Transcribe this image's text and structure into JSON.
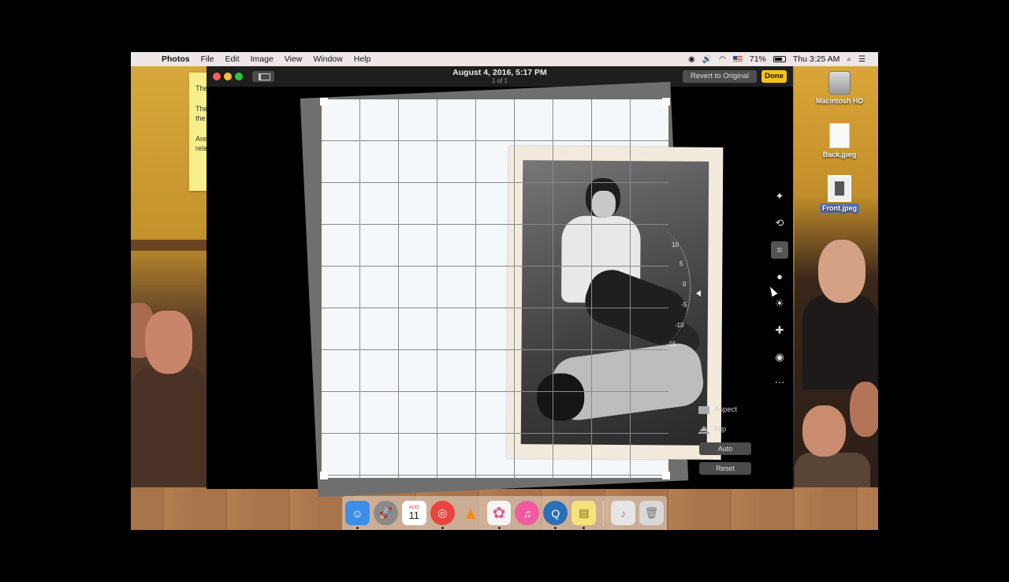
{
  "menubar": {
    "app_name": "Photos",
    "menus": [
      "File",
      "Edit",
      "Image",
      "View",
      "Window",
      "Help"
    ],
    "battery": "71%",
    "clock": "Thu 3:25 AM"
  },
  "sticky": {
    "lines": [
      "The",
      "The\nthe",
      "Are\nrela"
    ]
  },
  "desktop": {
    "icons": [
      {
        "label": "Macintosh HD"
      },
      {
        "label": "Back.jpeg"
      },
      {
        "label": "Front.jpeg"
      }
    ]
  },
  "window": {
    "title": "August 4, 2016, 5:17 PM",
    "subtitle": "1 of 1",
    "revert_label": "Revert to Original",
    "done_label": "Done"
  },
  "dial": {
    "ticks": [
      "10",
      "5",
      "0",
      "-5",
      "-10",
      "-15"
    ]
  },
  "tools": [
    {
      "name": "enhance-wand-icon",
      "glyph": "✦"
    },
    {
      "name": "rotate-icon",
      "glyph": "⟲"
    },
    {
      "name": "crop-icon",
      "glyph": "⌗"
    },
    {
      "name": "filters-icon",
      "glyph": "●"
    },
    {
      "name": "adjust-icon",
      "glyph": "☀"
    },
    {
      "name": "retouch-bandage-icon",
      "glyph": "✚"
    },
    {
      "name": "red-eye-icon",
      "glyph": "◉"
    },
    {
      "name": "more-icon",
      "glyph": "⋯"
    }
  ],
  "controls": {
    "aspect_label": "Aspect",
    "flip_label": "Flip",
    "auto_label": "Auto",
    "reset_label": "Reset"
  },
  "dock": {
    "calendar_month": "AUG",
    "calendar_day": "11",
    "items": [
      {
        "name": "finder",
        "color": "#3d8ee8",
        "glyph": "☺"
      },
      {
        "name": "launchpad",
        "color": "#8a8a8a",
        "glyph": "🚀"
      },
      {
        "name": "calendar",
        "color": "#ffffff",
        "glyph": ""
      },
      {
        "name": "chrome",
        "color": "#e8453c",
        "glyph": "◎"
      },
      {
        "name": "vlc",
        "color": "#f08a1c",
        "glyph": "▲"
      },
      {
        "name": "photos",
        "color": "#f5f5f5",
        "glyph": "✿"
      },
      {
        "name": "itunes",
        "color": "#f25aa0",
        "glyph": "♫"
      },
      {
        "name": "quicktime",
        "color": "#2a6fb8",
        "glyph": "Q"
      },
      {
        "name": "stickies",
        "color": "#f5e27a",
        "glyph": "▤"
      },
      {
        "name": "music-file",
        "color": "#e6e6e6",
        "glyph": "♪"
      },
      {
        "name": "trash",
        "color": "#d8d8d8",
        "glyph": "🗑"
      }
    ]
  }
}
